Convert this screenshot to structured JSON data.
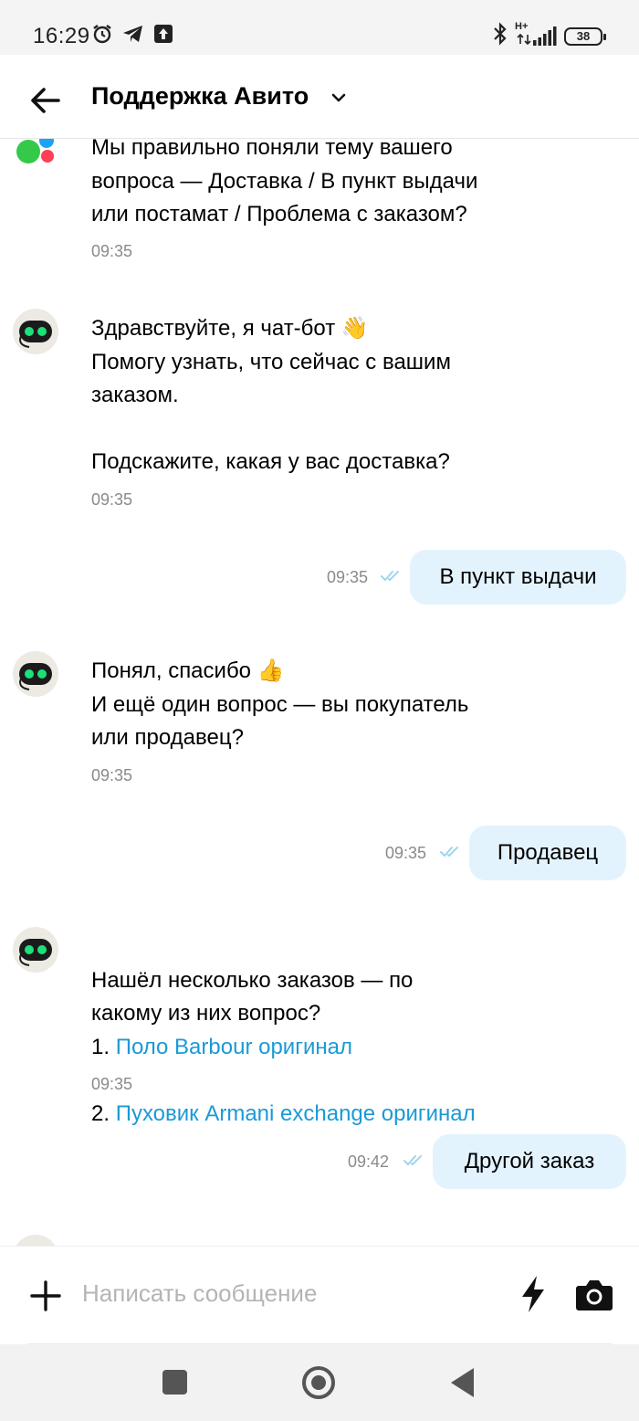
{
  "status_bar": {
    "time": "16:29",
    "network": "H+",
    "battery": "38"
  },
  "header": {
    "title": "Поддержка Авито"
  },
  "messages": [
    {
      "text": "Мы правильно поняли тему вашего\nвопроса — Доставка / В пункт выдачи\nили постамат / Проблема с заказом?",
      "time": "09:35"
    },
    {
      "text": "Здравствуйте, я чат-бот 👋\nПомогу узнать, что сейчас с вашим\nзаказом.\n\nПодскажите, какая у вас доставка?",
      "time": "09:35"
    },
    {
      "outgoing": true,
      "text": "В пункт выдачи",
      "time": "09:35"
    },
    {
      "text": "Понял, спасибо 👍\nИ ещё один вопрос — вы покупатель\nили продавец?",
      "time": "09:35"
    },
    {
      "outgoing": true,
      "text": "Продавец",
      "time": "09:35"
    },
    {
      "text": "Нашёл несколько заказов — по\nкакому из них вопрос?",
      "list": [
        {
          "num": "1. ",
          "link": "Поло Barbour оригинал"
        },
        {
          "num": "2. ",
          "link": "Пуховик Armani exchange оригинал"
        }
      ],
      "time": "09:35"
    },
    {
      "outgoing": true,
      "text": "Другой заказ",
      "time": "09:42"
    }
  ],
  "input": {
    "placeholder": "Написать сообщение"
  },
  "colors": {
    "link": "#1a9ad6",
    "outgoing_bubble": "#e3f3fd",
    "read_checks": "#9fd6ee"
  }
}
